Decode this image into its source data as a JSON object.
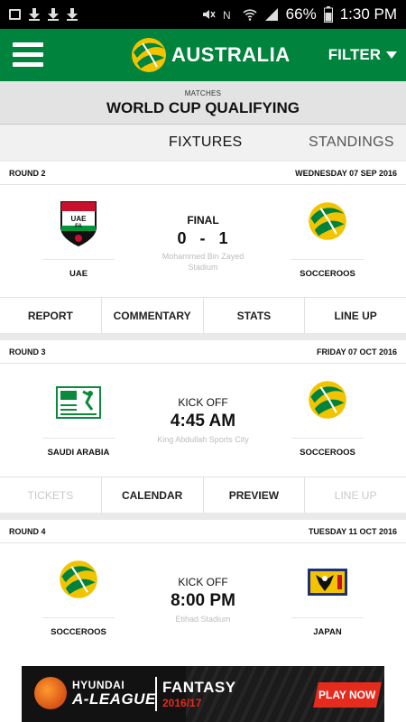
{
  "status_bar": {
    "battery": "66%",
    "time": "1:30 PM"
  },
  "app_bar": {
    "title": "AUSTRALIA",
    "filter_label": "FILTER"
  },
  "header": {
    "eyebrow": "MATCHES",
    "title": "WORLD CUP QUALIFYING"
  },
  "tabs": [
    {
      "label": "FIXTURES"
    },
    {
      "label": "STANDINGS"
    }
  ],
  "matches": [
    {
      "round": "ROUND 2",
      "date": "WEDNESDAY 07 SEP 2016",
      "home": "UAE",
      "away": "SOCCEROOS",
      "status": "FINAL",
      "home_score": "0",
      "sep": "-",
      "away_score": "1",
      "venue": "Mohammed Bin Zayed Stadium",
      "actions": [
        "REPORT",
        "COMMENTARY",
        "STATS",
        "LINE UP"
      ]
    },
    {
      "round": "ROUND 3",
      "date": "FRIDAY 07 OCT 2016",
      "home": "SAUDI ARABIA",
      "away": "SOCCEROOS",
      "status": "KICK OFF",
      "time": "4:45 AM",
      "venue": "King Abdullah Sports City",
      "actions": [
        "TICKETS",
        "CALENDAR",
        "PREVIEW",
        "LINE UP"
      ]
    },
    {
      "round": "ROUND 4",
      "date": "TUESDAY 11 OCT 2016",
      "home": "SOCCEROOS",
      "away": "JAPAN",
      "status": "KICK OFF",
      "time": "8:00 PM",
      "venue": "Etihad Stadium"
    }
  ],
  "ad": {
    "brand": "HYUNDAI",
    "league": "A-LEAGUE",
    "product": "FANTASY",
    "season": "2016/17",
    "cta": "PLAY NOW"
  },
  "colors": {
    "brand_green": "#00843d",
    "socceroos_gold": "#f2c400",
    "ad_red": "#e52b1e"
  }
}
